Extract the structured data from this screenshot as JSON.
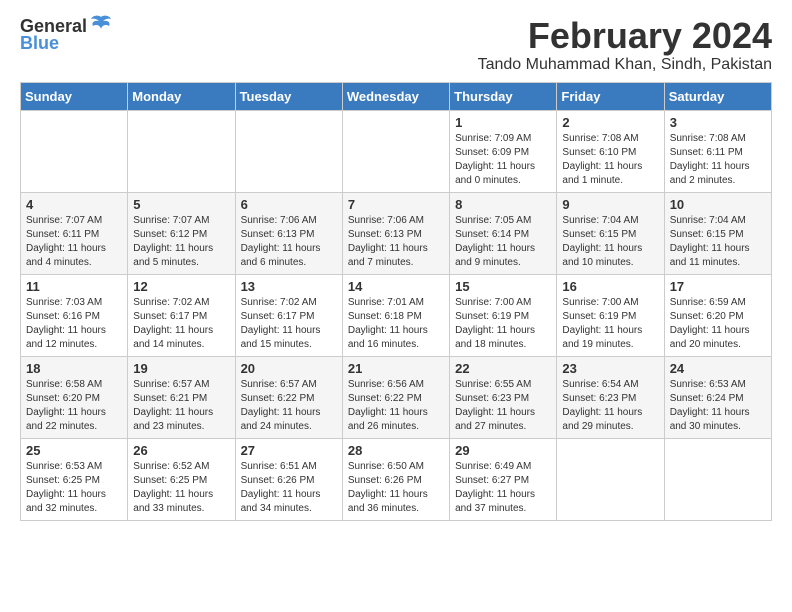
{
  "logo": {
    "general": "General",
    "blue": "Blue"
  },
  "header": {
    "title": "February 2024",
    "location": "Tando Muhammad Khan, Sindh, Pakistan"
  },
  "days_of_week": [
    "Sunday",
    "Monday",
    "Tuesday",
    "Wednesday",
    "Thursday",
    "Friday",
    "Saturday"
  ],
  "weeks": [
    [
      {
        "day": "",
        "info": ""
      },
      {
        "day": "",
        "info": ""
      },
      {
        "day": "",
        "info": ""
      },
      {
        "day": "",
        "info": ""
      },
      {
        "day": "1",
        "info": "Sunrise: 7:09 AM\nSunset: 6:09 PM\nDaylight: 11 hours\nand 0 minutes."
      },
      {
        "day": "2",
        "info": "Sunrise: 7:08 AM\nSunset: 6:10 PM\nDaylight: 11 hours\nand 1 minute."
      },
      {
        "day": "3",
        "info": "Sunrise: 7:08 AM\nSunset: 6:11 PM\nDaylight: 11 hours\nand 2 minutes."
      }
    ],
    [
      {
        "day": "4",
        "info": "Sunrise: 7:07 AM\nSunset: 6:11 PM\nDaylight: 11 hours\nand 4 minutes."
      },
      {
        "day": "5",
        "info": "Sunrise: 7:07 AM\nSunset: 6:12 PM\nDaylight: 11 hours\nand 5 minutes."
      },
      {
        "day": "6",
        "info": "Sunrise: 7:06 AM\nSunset: 6:13 PM\nDaylight: 11 hours\nand 6 minutes."
      },
      {
        "day": "7",
        "info": "Sunrise: 7:06 AM\nSunset: 6:13 PM\nDaylight: 11 hours\nand 7 minutes."
      },
      {
        "day": "8",
        "info": "Sunrise: 7:05 AM\nSunset: 6:14 PM\nDaylight: 11 hours\nand 9 minutes."
      },
      {
        "day": "9",
        "info": "Sunrise: 7:04 AM\nSunset: 6:15 PM\nDaylight: 11 hours\nand 10 minutes."
      },
      {
        "day": "10",
        "info": "Sunrise: 7:04 AM\nSunset: 6:15 PM\nDaylight: 11 hours\nand 11 minutes."
      }
    ],
    [
      {
        "day": "11",
        "info": "Sunrise: 7:03 AM\nSunset: 6:16 PM\nDaylight: 11 hours\nand 12 minutes."
      },
      {
        "day": "12",
        "info": "Sunrise: 7:02 AM\nSunset: 6:17 PM\nDaylight: 11 hours\nand 14 minutes."
      },
      {
        "day": "13",
        "info": "Sunrise: 7:02 AM\nSunset: 6:17 PM\nDaylight: 11 hours\nand 15 minutes."
      },
      {
        "day": "14",
        "info": "Sunrise: 7:01 AM\nSunset: 6:18 PM\nDaylight: 11 hours\nand 16 minutes."
      },
      {
        "day": "15",
        "info": "Sunrise: 7:00 AM\nSunset: 6:19 PM\nDaylight: 11 hours\nand 18 minutes."
      },
      {
        "day": "16",
        "info": "Sunrise: 7:00 AM\nSunset: 6:19 PM\nDaylight: 11 hours\nand 19 minutes."
      },
      {
        "day": "17",
        "info": "Sunrise: 6:59 AM\nSunset: 6:20 PM\nDaylight: 11 hours\nand 20 minutes."
      }
    ],
    [
      {
        "day": "18",
        "info": "Sunrise: 6:58 AM\nSunset: 6:20 PM\nDaylight: 11 hours\nand 22 minutes."
      },
      {
        "day": "19",
        "info": "Sunrise: 6:57 AM\nSunset: 6:21 PM\nDaylight: 11 hours\nand 23 minutes."
      },
      {
        "day": "20",
        "info": "Sunrise: 6:57 AM\nSunset: 6:22 PM\nDaylight: 11 hours\nand 24 minutes."
      },
      {
        "day": "21",
        "info": "Sunrise: 6:56 AM\nSunset: 6:22 PM\nDaylight: 11 hours\nand 26 minutes."
      },
      {
        "day": "22",
        "info": "Sunrise: 6:55 AM\nSunset: 6:23 PM\nDaylight: 11 hours\nand 27 minutes."
      },
      {
        "day": "23",
        "info": "Sunrise: 6:54 AM\nSunset: 6:23 PM\nDaylight: 11 hours\nand 29 minutes."
      },
      {
        "day": "24",
        "info": "Sunrise: 6:53 AM\nSunset: 6:24 PM\nDaylight: 11 hours\nand 30 minutes."
      }
    ],
    [
      {
        "day": "25",
        "info": "Sunrise: 6:53 AM\nSunset: 6:25 PM\nDaylight: 11 hours\nand 32 minutes."
      },
      {
        "day": "26",
        "info": "Sunrise: 6:52 AM\nSunset: 6:25 PM\nDaylight: 11 hours\nand 33 minutes."
      },
      {
        "day": "27",
        "info": "Sunrise: 6:51 AM\nSunset: 6:26 PM\nDaylight: 11 hours\nand 34 minutes."
      },
      {
        "day": "28",
        "info": "Sunrise: 6:50 AM\nSunset: 6:26 PM\nDaylight: 11 hours\nand 36 minutes."
      },
      {
        "day": "29",
        "info": "Sunrise: 6:49 AM\nSunset: 6:27 PM\nDaylight: 11 hours\nand 37 minutes."
      },
      {
        "day": "",
        "info": ""
      },
      {
        "day": "",
        "info": ""
      }
    ]
  ]
}
